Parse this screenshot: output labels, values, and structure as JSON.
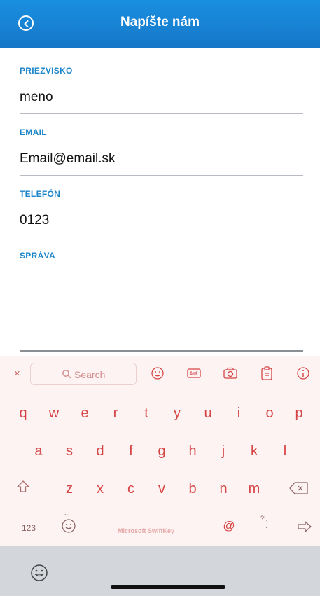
{
  "header": {
    "title": "Napíšte nám"
  },
  "form": {
    "fields": [
      {
        "label": "PRIEZVISKO",
        "value": "meno"
      },
      {
        "label": "EMAIL",
        "value": "Email@email.sk"
      },
      {
        "label": "TELEFÓN",
        "value": "0123"
      },
      {
        "label": "SPRÁVA",
        "value": ""
      }
    ]
  },
  "keyboard": {
    "search_placeholder": "Search",
    "close_label": "×",
    "brand": "Microsoft SwiftKey",
    "row1": [
      "q",
      "w",
      "e",
      "r",
      "t",
      "y",
      "u",
      "i",
      "o",
      "p"
    ],
    "row2": [
      "a",
      "s",
      "d",
      "f",
      "g",
      "h",
      "j",
      "k",
      "l"
    ],
    "row3": [
      "z",
      "x",
      "c",
      "v",
      "b",
      "n",
      "m"
    ],
    "numbers_label": "123",
    "at_label": "@",
    "punct_label": "?!,",
    "dots_label": "...",
    "period_label": "."
  },
  "colors": {
    "header": "#1677c8",
    "label": "#1d86c9",
    "key": "#d64545",
    "keyboard_bg": "#fdf3f3"
  }
}
